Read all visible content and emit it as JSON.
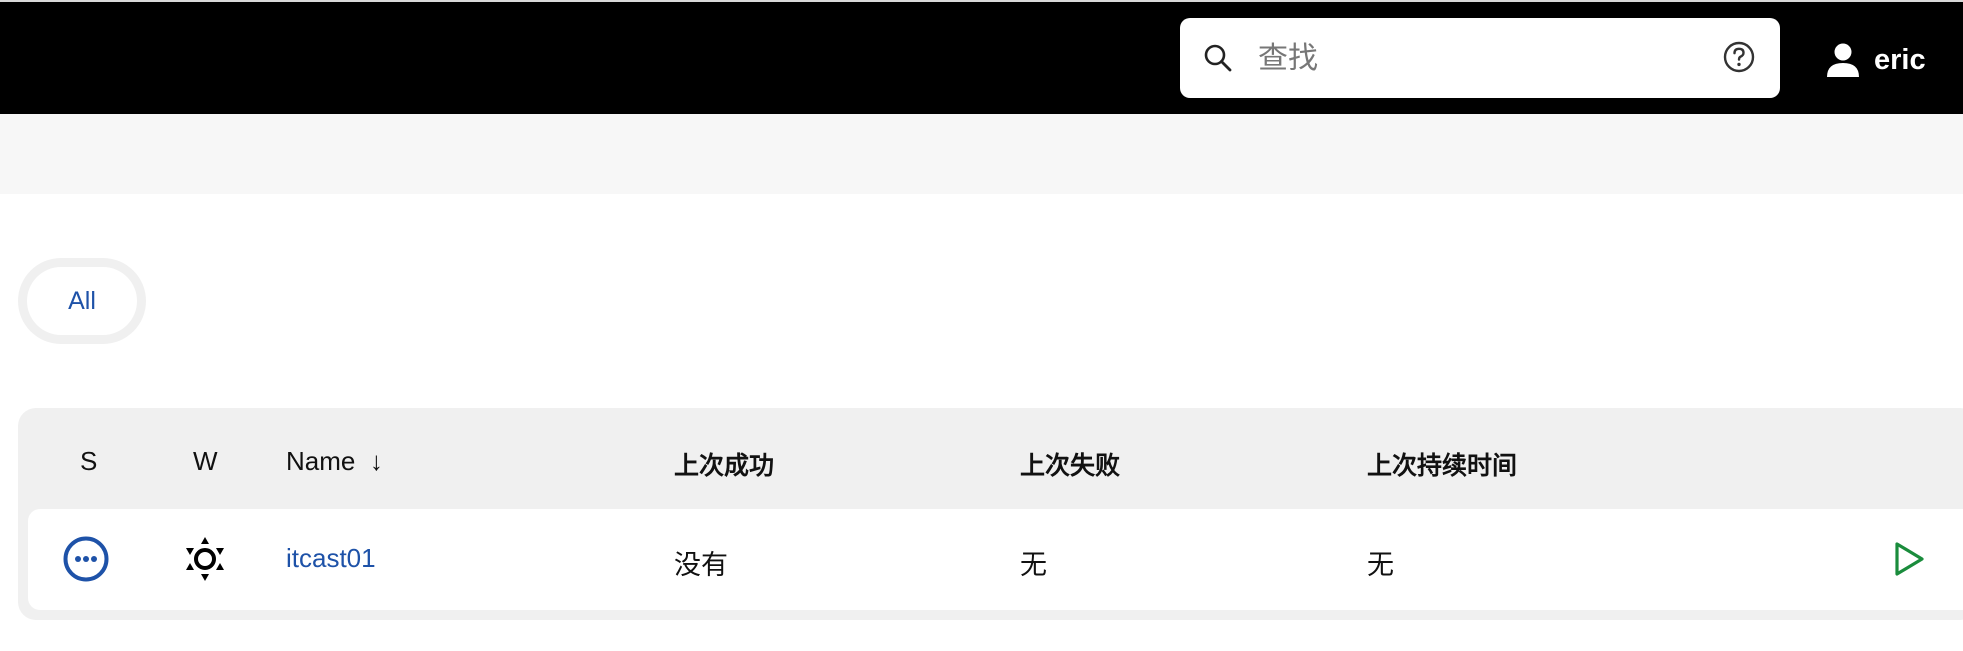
{
  "header": {
    "search": {
      "placeholder": "查找",
      "icon": "search-icon",
      "help_icon": "help-icon"
    },
    "user": {
      "name": "eric",
      "icon": "user-icon"
    }
  },
  "views": {
    "tabs": [
      {
        "label": "All",
        "active": true
      }
    ]
  },
  "table": {
    "columns": {
      "status": "S",
      "weather": "W",
      "name": "Name",
      "name_sort_indicator": "↓",
      "last_success": "上次成功",
      "last_failure": "上次失败",
      "last_duration": "上次持续时间"
    },
    "rows": [
      {
        "status_icon": "status-not-built-icon",
        "weather_icon": "weather-sunny-icon",
        "name": "itcast01",
        "last_success": "没有",
        "last_failure": "无",
        "last_duration": "无",
        "action_icon": "build-run-icon"
      }
    ]
  },
  "colors": {
    "link": "#1e52a8",
    "status_ring": "#1e52a8",
    "run_action": "#1a8c3c",
    "topbar": "#000000"
  }
}
